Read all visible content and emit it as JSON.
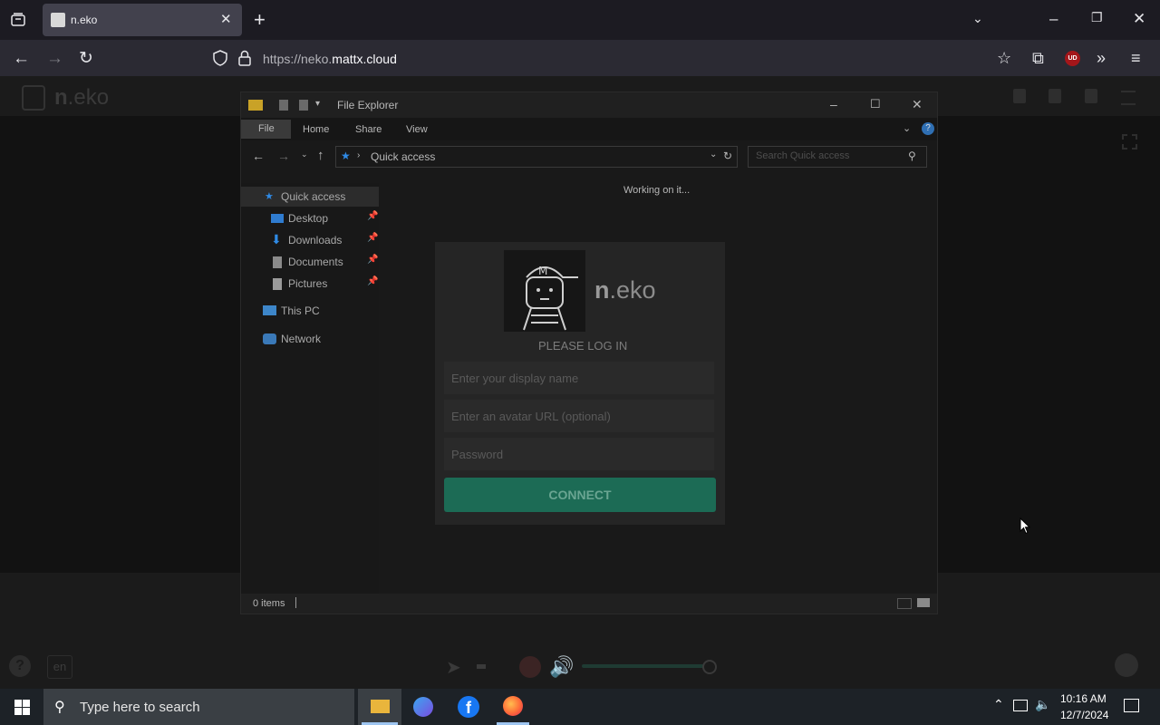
{
  "browser": {
    "tab_title": "n.eko",
    "url_prefix": "https://neko.",
    "url_domain": "mattx.cloud",
    "extension_badge": "UD"
  },
  "neko": {
    "logo_bold": "n",
    "logo_rest": ".eko",
    "lang": "en",
    "help": "?"
  },
  "file_explorer": {
    "title": "File Explorer",
    "ribbon_tabs": [
      "File",
      "Home",
      "Share",
      "View"
    ],
    "address": "Quick access",
    "search_placeholder": "Search Quick access",
    "working_text": "Working on it...",
    "nav": {
      "quick_access": "Quick access",
      "desktop": "Desktop",
      "downloads": "Downloads",
      "documents": "Documents",
      "pictures": "Pictures",
      "this_pc": "This PC",
      "network": "Network"
    },
    "status": "0 items"
  },
  "login": {
    "logo_bold": "n",
    "logo_rest": ".eko",
    "heading": "PLEASE LOG IN",
    "display_name_placeholder": "Enter your display name",
    "avatar_placeholder": "Enter an avatar URL (optional)",
    "password_placeholder": "Password",
    "connect_label": "CONNECT"
  },
  "taskbar": {
    "search_placeholder": "Type here to search",
    "time": "10:16 AM",
    "date": "12/7/2024"
  },
  "colors": {
    "connect": "#1c6b55",
    "accent_blue": "#2f8ae5"
  }
}
